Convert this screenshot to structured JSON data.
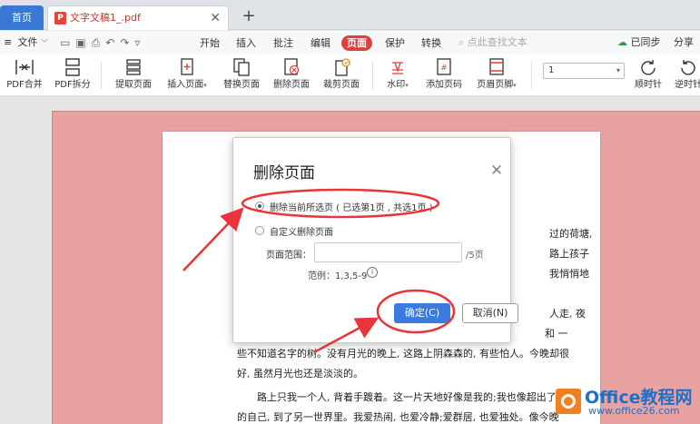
{
  "tabs": {
    "home": "首页",
    "doc_title": "文字文稿1_.pdf",
    "pdf_badge": "P",
    "close": "✕",
    "add": "+"
  },
  "menubar": {
    "file": "文件",
    "items": [
      "开始",
      "插入",
      "批注",
      "编辑",
      "页面",
      "保护",
      "转换"
    ],
    "active": "页面",
    "search": "点此查找文本",
    "sync": "已同步",
    "share": "分享"
  },
  "toolbar": {
    "tools": [
      "PDF合并",
      "PDF拆分",
      "提取页面",
      "插入页面",
      "替换页面",
      "删除页面",
      "裁剪页面",
      "水印",
      "添加页码",
      "页眉页脚",
      "顺时针",
      "逆时针"
    ],
    "page_select_value": "1"
  },
  "document": {
    "lines": [
      "过的荷塘,",
      "路上孩子",
      "我悄悄地",
      "人走, 夜",
      "和 一",
      "些不知道名字的树。没有月光的晚上, 这路上阴森森的, 有些怕人。今晚却很",
      "好, 虽然月光也还是淡淡的。",
      "路上只我一个人, 背着手踱着。这一片天地好像是我的;我也像超出了",
      "的自己, 到了另一世界里。我爱热闹, 也爱冷静;爱群居, 也爱独处。像今晚"
    ]
  },
  "dialog": {
    "title": "删除页面",
    "close": "✕",
    "option_current": "删除当前所选页 ( 已选第1页 , 共选1页 )",
    "option_custom": "自定义删除页面",
    "range_label": "页面范围：",
    "range_value": "",
    "range_suffix": "/5页",
    "example": "范例：1,3,5-9",
    "info": "i",
    "ok": "确定(C)",
    "cancel": "取消(N)"
  },
  "watermark": {
    "title": "Office教程网",
    "url": "www.office26.com"
  },
  "colors": {
    "accent_red": "#e0403a",
    "primary_blue": "#3a7be0",
    "page_pink": "#e8a2a2",
    "annotation_red": "#e8343a"
  }
}
